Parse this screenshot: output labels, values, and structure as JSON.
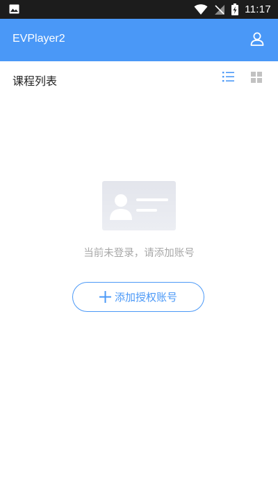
{
  "status_bar": {
    "time": "11:17"
  },
  "app_bar": {
    "title": "EVPlayer2"
  },
  "list_header": {
    "label": "课程列表"
  },
  "empty_state": {
    "message": "当前未登录，请添加账号",
    "add_button_label": "添加授权账号"
  },
  "colors": {
    "accent": "#4a98f7",
    "status_bar": "#1c1c1c",
    "muted_text": "#a8a8a8"
  }
}
